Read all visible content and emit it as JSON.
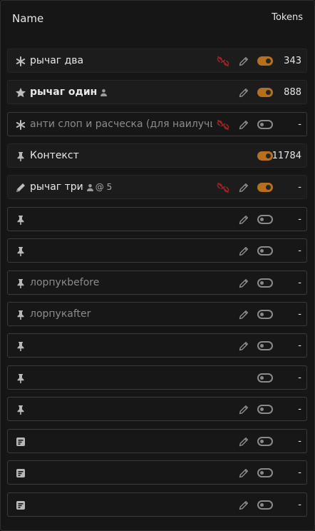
{
  "header": {
    "name_label": "Name",
    "tokens_label": "Tokens"
  },
  "colors": {
    "accent_toggle_on": "#b66f1d",
    "broken_link": "#9a2323",
    "background": "#161616"
  },
  "rows": [
    {
      "lead_icon": "asterisk-icon",
      "title": "рычаг два",
      "style": "normal",
      "broken_link": true,
      "pencil": true,
      "toggle_on": true,
      "tokens": "343"
    },
    {
      "lead_icon": "star-icon",
      "title": "рычаг один",
      "style": "bold",
      "user_icon": true,
      "broken_link": false,
      "pencil": true,
      "toggle_on": true,
      "tokens": "888"
    },
    {
      "lead_icon": "asterisk-icon",
      "title": "анти слоп и расческа (для наилучш",
      "style": "dim",
      "broken_link": true,
      "pencil": true,
      "toggle_on": false,
      "tokens": "-"
    },
    {
      "lead_icon": "pin-icon",
      "title": "Контекст",
      "style": "normal",
      "broken_link": false,
      "pencil": false,
      "toggle_on": true,
      "tokens": "11784"
    },
    {
      "lead_icon": "pencil-icon",
      "title": "рычаг три",
      "style": "normal",
      "user_icon": true,
      "at_count": "@ 5",
      "broken_link": true,
      "pencil": true,
      "toggle_on": true,
      "tokens": "-"
    },
    {
      "lead_icon": "pin-icon",
      "title": "",
      "style": "dim",
      "broken_link": false,
      "pencil": true,
      "toggle_on": false,
      "tokens": "-"
    },
    {
      "lead_icon": "pin-icon",
      "title": "",
      "style": "dim",
      "broken_link": false,
      "pencil": true,
      "toggle_on": false,
      "tokens": "-"
    },
    {
      "lead_icon": "pin-icon",
      "title": "лорпукbefore",
      "style": "dim",
      "broken_link": false,
      "pencil": true,
      "toggle_on": false,
      "tokens": "-"
    },
    {
      "lead_icon": "pin-icon",
      "title": "лорпукafter",
      "style": "dim",
      "broken_link": false,
      "pencil": true,
      "toggle_on": false,
      "tokens": "-"
    },
    {
      "lead_icon": "pin-icon",
      "title": "",
      "style": "dim",
      "broken_link": false,
      "pencil": true,
      "toggle_on": false,
      "tokens": "-"
    },
    {
      "lead_icon": "pin-icon",
      "title": "",
      "style": "dim",
      "broken_link": false,
      "pencil": false,
      "toggle_on": false,
      "tokens": "-"
    },
    {
      "lead_icon": "pin-icon",
      "title": "",
      "style": "dim",
      "broken_link": false,
      "pencil": true,
      "toggle_on": false,
      "tokens": "-"
    },
    {
      "lead_icon": "list-icon",
      "title": "",
      "style": "dim",
      "broken_link": false,
      "pencil": true,
      "toggle_on": false,
      "tokens": "-"
    },
    {
      "lead_icon": "list-icon",
      "title": "",
      "style": "dim",
      "broken_link": false,
      "pencil": true,
      "toggle_on": false,
      "tokens": "-"
    },
    {
      "lead_icon": "list-icon",
      "title": "",
      "style": "dim",
      "broken_link": false,
      "pencil": true,
      "toggle_on": false,
      "tokens": "-"
    }
  ]
}
